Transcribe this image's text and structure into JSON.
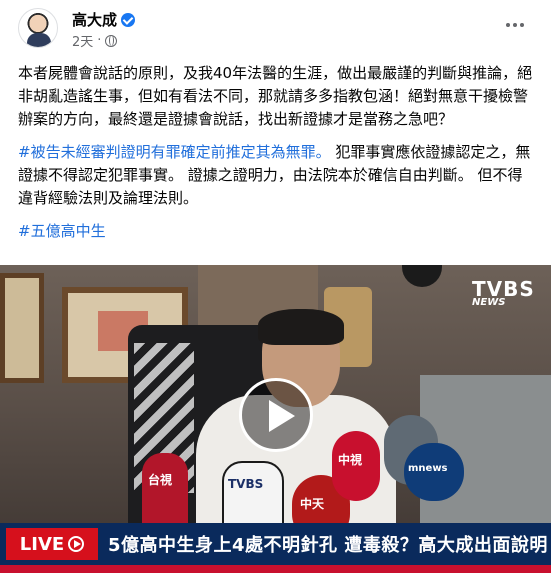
{
  "post": {
    "author": "高大成",
    "time": "2天",
    "paragraph1": "本者屍體會說話的原則，及我40年法醫的生涯，做出最嚴謹的判斷與推論，絕非胡亂造謠生事，但如有看法不同，那就請多多指教包涵！絕對無意干擾檢警辦案的方向，最終還是證據會說話，找出新證據才是當務之急吧？",
    "hashtag1": "#被告未經審判證明有罪確定前推定其為無罪。",
    "paragraph2_rest": "犯罪事實應依證據認定之，無證據不得認定犯罪事實。 證據之證明力，由法院本於確信自由判斷。 但不得違背經驗法則及論理法則。",
    "hashtag2": "#五億高中生"
  },
  "video": {
    "live_label": "LIVE",
    "headline": "5億高中生身上4處不明針孔 遭毒殺？高大成出面說明",
    "channel_logo": "TVBS",
    "channel_sub": "NEWS",
    "mic_labels": {
      "mic1": "台視",
      "mic2": "TVBS",
      "mic3": "中天",
      "mic4": "中視",
      "mic5": "mnews"
    }
  },
  "icons": {
    "verified": "verified-badge-icon",
    "privacy": "globe-icon",
    "more": "more-options-icon",
    "play": "play-icon"
  },
  "colors": {
    "hashtag": "#216fdb",
    "verified": "#1877f2",
    "live_red": "#d6101c",
    "ticker_blue": "#0a2a5c"
  }
}
